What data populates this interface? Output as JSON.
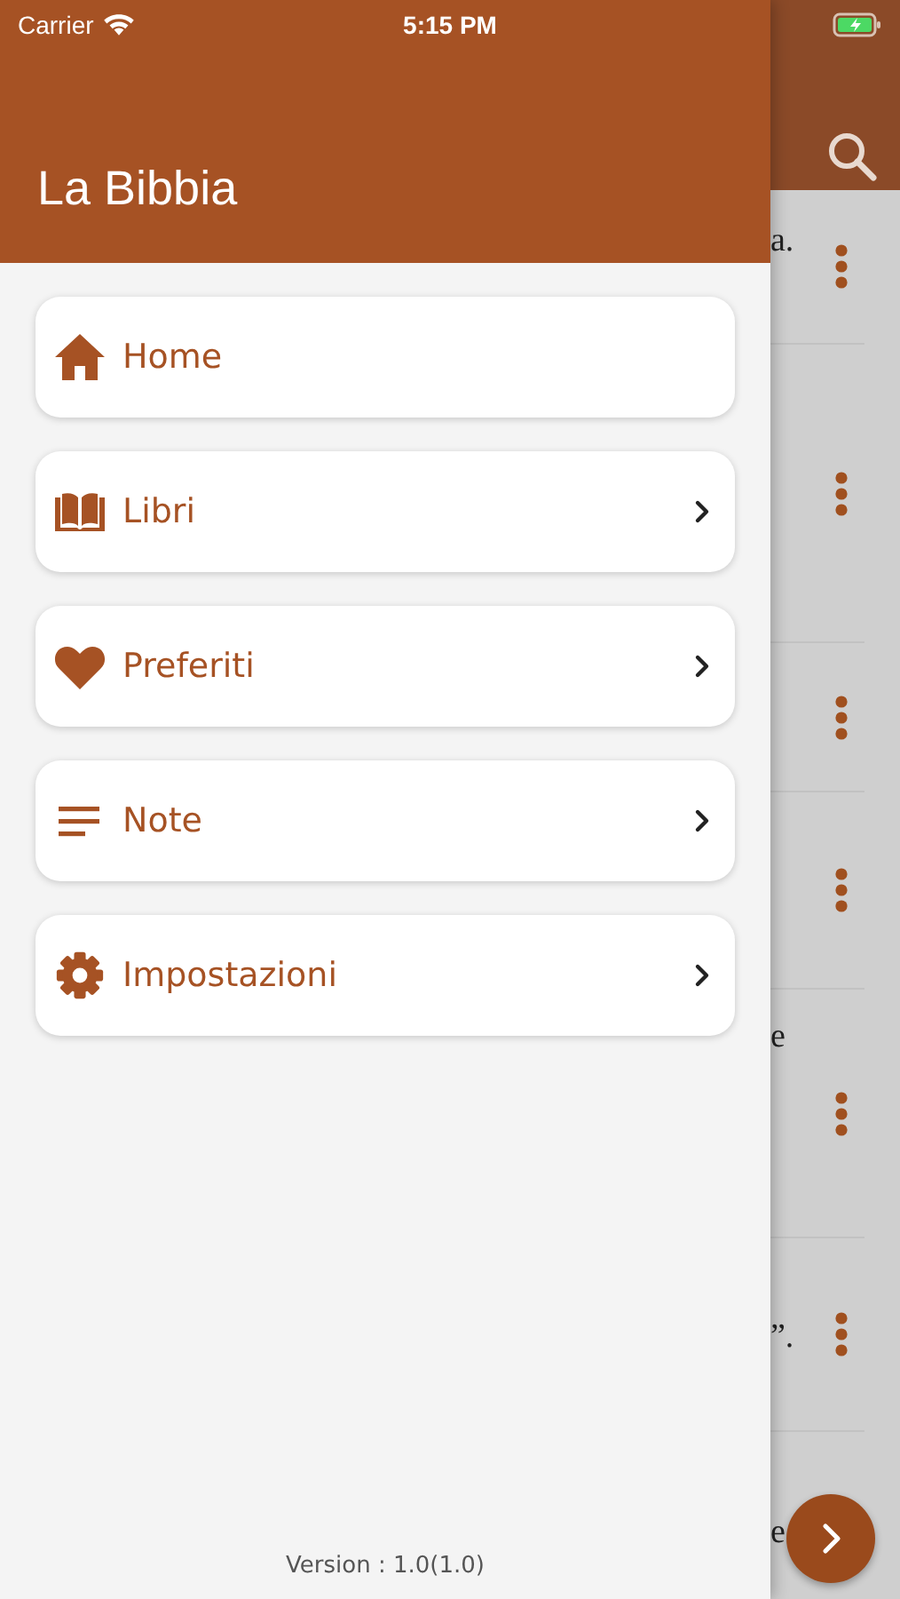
{
  "status_bar": {
    "carrier": "Carrier",
    "time": "5:15 PM"
  },
  "drawer": {
    "title": "La Bibbia",
    "items": [
      {
        "label": "Home",
        "chevron": false
      },
      {
        "label": "Libri",
        "chevron": true
      },
      {
        "label": "Preferiti",
        "chevron": true
      },
      {
        "label": "Note",
        "chevron": true
      },
      {
        "label": "Impostazioni",
        "chevron": true
      }
    ],
    "version": "Version : 1.0(1.0)"
  },
  "background_list": {
    "rows": [
      {
        "fragment": "a."
      },
      {},
      {},
      {},
      {
        "fragment": "e"
      },
      {
        "fragment": "”."
      },
      {
        "fragment": "e"
      }
    ]
  }
}
